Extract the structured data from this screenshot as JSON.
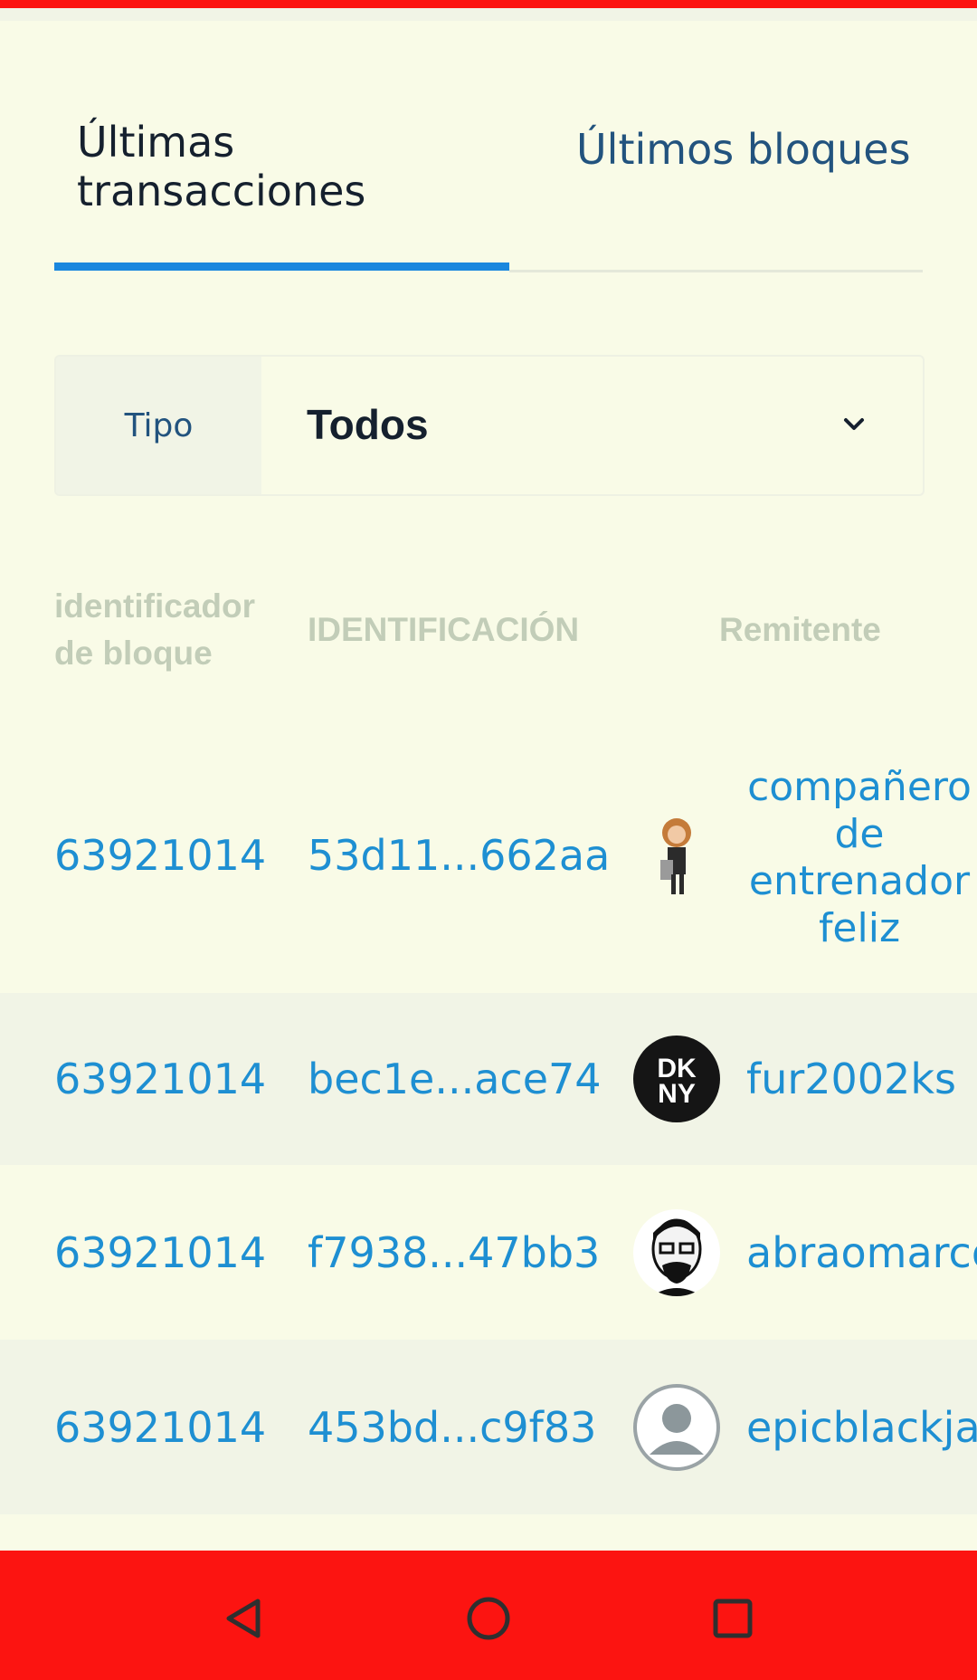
{
  "tabs": [
    {
      "label": "Últimas transacciones",
      "active": true
    },
    {
      "label": "Últimos bloques",
      "active": false
    }
  ],
  "filter": {
    "label": "Tipo",
    "value": "Todos"
  },
  "table": {
    "headers": [
      "identificador de bloque",
      "IDENTIFICACIÓN",
      "Remitente"
    ],
    "rows": [
      {
        "block": "63921014",
        "id": "53d11...662aa",
        "sender": "compañero de entrenador feliz",
        "avatar": "illustrated-character-avatar"
      },
      {
        "block": "63921014",
        "id": "bec1e...ace74",
        "sender": "fur2002ks",
        "avatar": "dkny-logo-avatar"
      },
      {
        "block": "63921014",
        "id": "f7938...47bb3",
        "sender": "abraomarco",
        "avatar": "bearded-man-avatar"
      },
      {
        "block": "63921014",
        "id": "453bd...c9f83",
        "sender": "epicblackjac",
        "avatar": "default-user-avatar"
      }
    ]
  },
  "avatar_text": {
    "dkny_top": "DK",
    "dkny_bottom": "NY"
  },
  "navbar": {
    "buttons": [
      "back",
      "home",
      "recents"
    ]
  },
  "colors": {
    "accent": "#1a87de",
    "link": "#1e8fd2",
    "system_bar": "#fc1411",
    "background": "#f9fbe7"
  }
}
